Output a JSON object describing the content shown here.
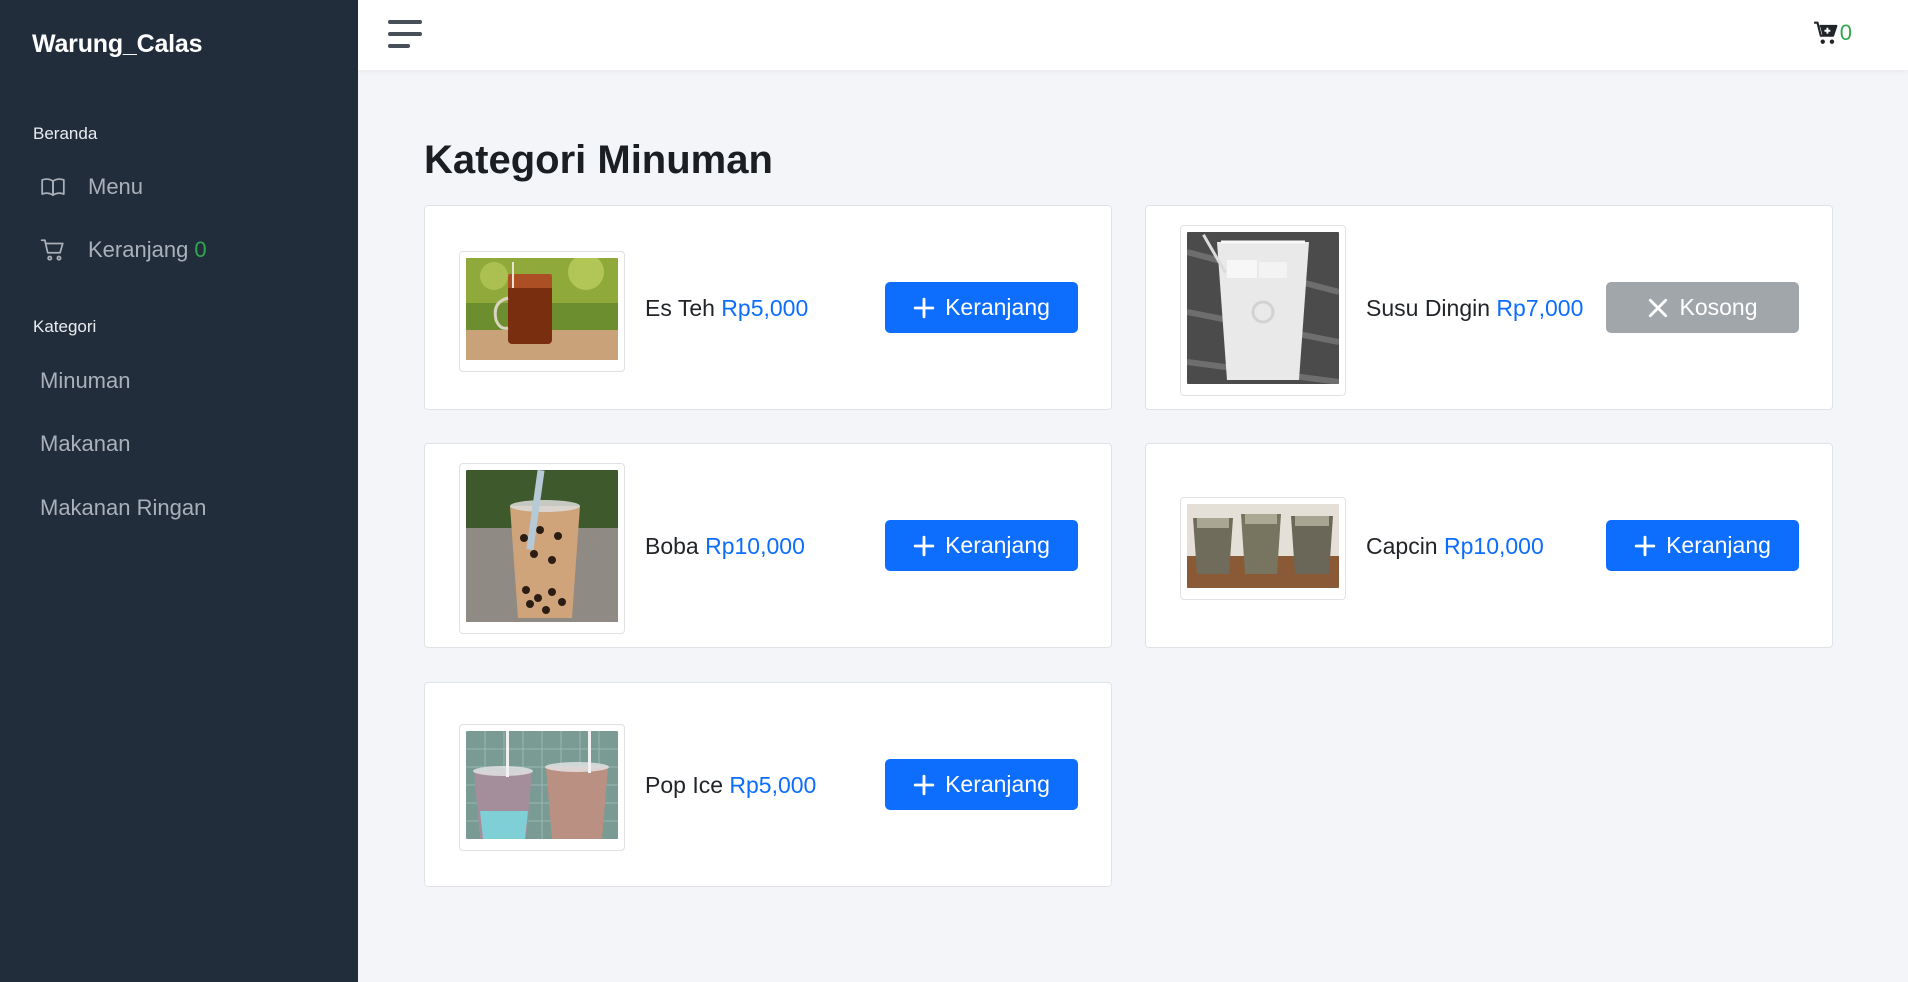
{
  "sidebar": {
    "brand": "Warung_Calas",
    "beranda_heading": "Beranda",
    "menu_label": "Menu",
    "cart_label": "Keranjang",
    "cart_count": "0",
    "kategori_heading": "Kategori",
    "categories": [
      "Minuman",
      "Makanan",
      "Makanan Ringan"
    ]
  },
  "topbar": {
    "cart_count": "0",
    "icons": [
      "hamburger-icon",
      "cart-plus-icon"
    ]
  },
  "page": {
    "title_bold": "Kategori",
    "title_rest": "Minuman"
  },
  "products": [
    {
      "name": "Es Teh",
      "price": "Rp5,000",
      "button": "Keranjang",
      "available": true
    },
    {
      "name": "Susu Dingin",
      "price": "Rp7,000",
      "button": "Kosong",
      "available": false
    },
    {
      "name": "Boba",
      "price": "Rp10,000",
      "button": "Keranjang",
      "available": true
    },
    {
      "name": "Capcin",
      "price": "Rp10,000",
      "button": "Keranjang",
      "available": true
    },
    {
      "name": "Pop Ice",
      "price": "Rp5,000",
      "button": "Keranjang",
      "available": true
    }
  ],
  "colors": {
    "sidebar_bg": "#222d3c",
    "accent": "#0d6efd",
    "count_green": "#2fa84f",
    "disabled_button": "#a1a6ab"
  }
}
